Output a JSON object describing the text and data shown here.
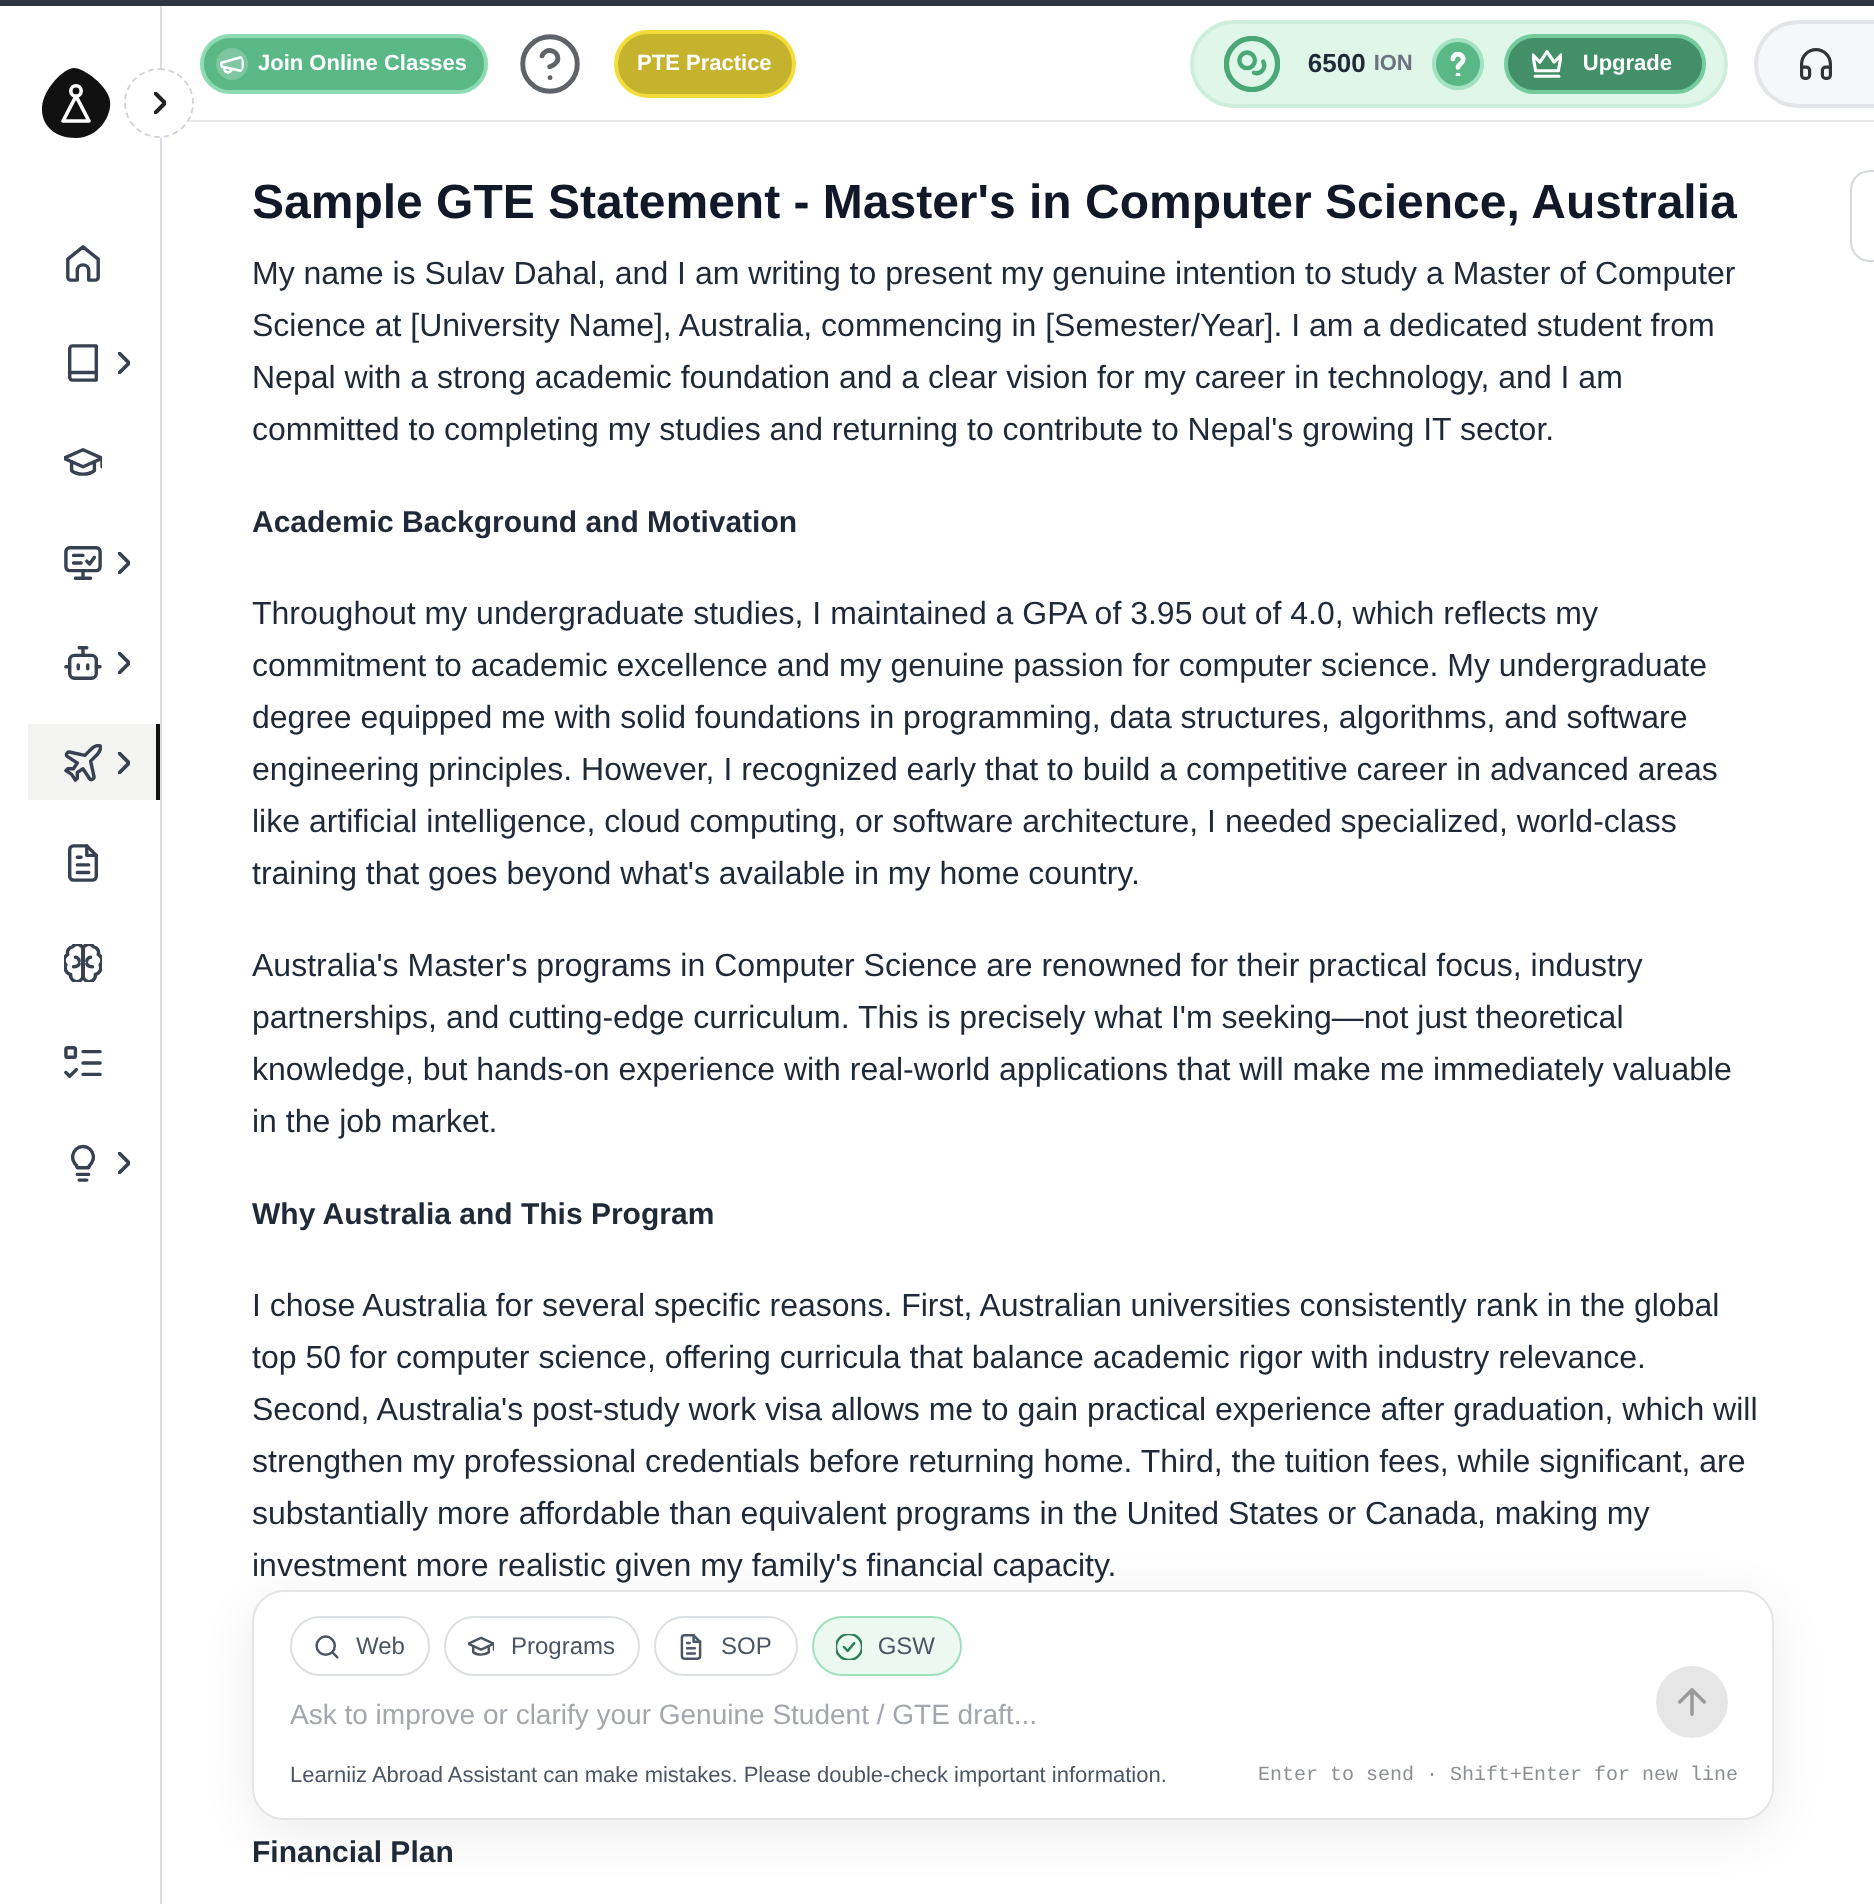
{
  "sidebar": {
    "items": [
      {
        "selected": false,
        "expandable": false
      },
      {
        "selected": false,
        "expandable": true
      },
      {
        "selected": false,
        "expandable": false
      },
      {
        "selected": false,
        "expandable": true
      },
      {
        "selected": false,
        "expandable": true
      },
      {
        "selected": true,
        "expandable": true
      },
      {
        "selected": false,
        "expandable": false
      },
      {
        "selected": false,
        "expandable": false
      },
      {
        "selected": false,
        "expandable": false
      },
      {
        "selected": false,
        "expandable": true
      }
    ]
  },
  "top_bar": {
    "join_button": {
      "label": "Join Online Classes"
    },
    "practice_button": {
      "label": "PTE Practice"
    },
    "credits": {
      "amount": "6500",
      "unit": "ION",
      "upgrade_label": "Upgrade"
    }
  },
  "document": {
    "title": "Sample GTE Statement - Master's in Computer Science, Australia",
    "blocks": [
      {
        "kind": "paragraph",
        "text": "My name is Sulav Dahal, and I am writing to present my genuine intention to study a Master of Computer Science at [University Name], Australia, commencing in [Semester/Year]. I am a dedicated student from Nepal with a strong academic foundation and a clear vision for my career in technology, and I am committed to completing my studies and returning to contribute to Nepal's growing IT sector."
      },
      {
        "kind": "heading",
        "text": "Academic Background and Motivation"
      },
      {
        "kind": "paragraph",
        "text": "Throughout my undergraduate studies, I maintained a GPA of 3.95 out of 4.0, which reflects my commitment to academic excellence and my genuine passion for computer science. My undergraduate degree equipped me with solid foundations in programming, data structures, algorithms, and software engineering principles. However, I recognized early that to build a competitive career in advanced areas like artificial intelligence, cloud computing, or software architecture, I needed specialized, world-class training that goes beyond what's available in my home country."
      },
      {
        "kind": "paragraph",
        "text": "Australia's Master's programs in Computer Science are renowned for their practical focus, industry partnerships, and cutting-edge curriculum. This is precisely what I'm seeking—not just theoretical knowledge, but hands-on experience with real-world applications that will make me immediately valuable in the job market."
      },
      {
        "kind": "heading",
        "text": "Why Australia and This Program"
      },
      {
        "kind": "paragraph",
        "text": "I chose Australia for several specific reasons. First, Australian universities consistently rank in the global top 50 for computer science, offering curricula that balance academic rigor with industry relevance. Second, Australia's post-study work visa allows me to gain practical experience after graduation, which will strengthen my professional credentials before returning home. Third, the tuition fees, while significant, are substantially more affordable than equivalent programs in the United States or Canada, making my investment more realistic given my family's financial capacity."
      }
    ],
    "blocks_below_assistant": [
      {
        "kind": "heading",
        "text": "Financial Plan"
      }
    ]
  },
  "assistant": {
    "tools": [
      {
        "label": "Web",
        "selected": false
      },
      {
        "label": "Programs",
        "selected": false
      },
      {
        "label": "SOP",
        "selected": false
      },
      {
        "label": "GSW",
        "selected": true
      }
    ],
    "placeholder": "Ask to improve or clarify your Genuine Student / GTE draft...",
    "disclaimer": "Learniiz Abroad Assistant can make mistakes. Please double-check important information.",
    "hint": "Enter to send · Shift+Enter for new line"
  }
}
